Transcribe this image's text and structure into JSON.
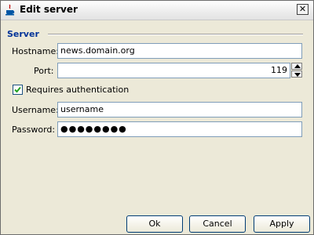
{
  "window": {
    "title": "Edit server",
    "close_glyph": "✕",
    "icon": "java-cup-icon"
  },
  "group": {
    "label": "Server"
  },
  "fields": {
    "hostname": {
      "label": "Hostname:",
      "value": "news.domain.org"
    },
    "port": {
      "label": "Port:",
      "value": "119"
    },
    "requires_auth": {
      "label": "Requires authentication",
      "checked": true
    },
    "username": {
      "label": "Username:",
      "value": "username"
    },
    "password": {
      "label": "Password:",
      "value": "●●●●●●●●"
    }
  },
  "buttons": {
    "ok": "Ok",
    "cancel": "Cancel",
    "apply": "Apply"
  },
  "colors": {
    "group_label": "#003399",
    "field_border": "#7f9db9",
    "dialog_bg": "#ece9d8"
  }
}
